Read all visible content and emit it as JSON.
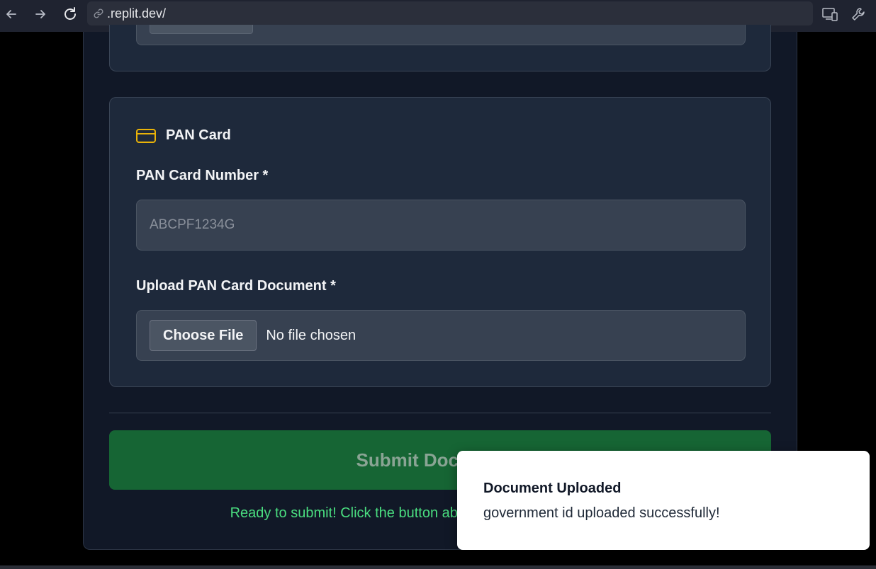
{
  "browser": {
    "url_prefix": "",
    "url_text": ".replit.dev/",
    "back_icon": "arrow-left-icon",
    "forward_icon": "arrow-right-icon",
    "reload_icon": "reload-icon",
    "devices_icon": "devices-icon",
    "tools_icon": "wrench-icon"
  },
  "pan_section": {
    "title": "PAN Card",
    "icon": "credit-card-icon",
    "number_label": "PAN Card Number *",
    "number_placeholder": "ABCPF1234G",
    "upload_label": "Upload PAN Card Document *",
    "choose_file_label": "Choose File",
    "no_file_text": "No file chosen"
  },
  "submit": {
    "label": "Submit Documents"
  },
  "status": {
    "ready_text": "Ready to submit! Click the button above to upload your documents."
  },
  "toast": {
    "title": "Document Uploaded",
    "message": "government id uploaded successfully!"
  },
  "colors": {
    "accent_icon": "#eab308",
    "submit_bg": "#166534",
    "ready_text": "#4ade80"
  }
}
